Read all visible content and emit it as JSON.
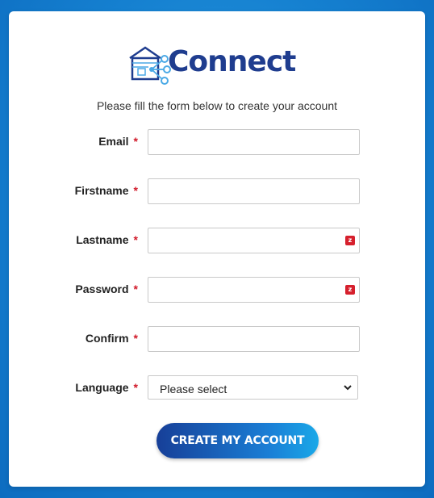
{
  "brand": {
    "name": "Connect"
  },
  "intro": "Please fill the form below to create your account",
  "required_mark": "*",
  "fields": [
    {
      "label": "Email",
      "value": "",
      "badge": ""
    },
    {
      "label": "Firstname",
      "value": "",
      "badge": ""
    },
    {
      "label": "Lastname",
      "value": "",
      "badge": "z"
    },
    {
      "label": "Password",
      "value": "",
      "badge": "z"
    },
    {
      "label": "Confirm",
      "value": "",
      "badge": ""
    }
  ],
  "language": {
    "label": "Language",
    "selected": "Please select"
  },
  "submit_label": "CREATE MY ACCOUNT",
  "colors": {
    "brand_blue": "#1f3d8f",
    "required_red": "#d11a2a",
    "background": "#1580d0"
  }
}
